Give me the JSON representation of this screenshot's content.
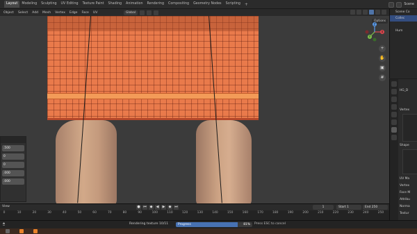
{
  "app": {
    "workspaces": [
      "Layout",
      "Modeling",
      "Sculpting",
      "UV Editing",
      "Texture Paint",
      "Shading",
      "Animation",
      "Rendering",
      "Compositing",
      "Geometry Nodes",
      "Scripting"
    ],
    "active_workspace": "Layout",
    "add_workspace": "+",
    "scene_label": "Scene"
  },
  "header": {
    "menus": [
      "Object",
      "Select",
      "Add",
      "Mesh",
      "Vertex",
      "Edge",
      "Face",
      "UV"
    ],
    "transform": "Global",
    "options": "Options"
  },
  "viewport": {
    "gizmo_axes": [
      "X",
      "Y",
      "Z"
    ]
  },
  "operator_panel": {
    "values": [
      ".500",
      "0",
      "0",
      ".000",
      ".000"
    ]
  },
  "timeline": {
    "menu": "View",
    "current_frame": "1",
    "start_label": "Start",
    "start": "1",
    "end_label": "End",
    "end": "250",
    "ruler": [
      "0",
      "10",
      "20",
      "30",
      "40",
      "50",
      "60",
      "70",
      "80",
      "90",
      "100",
      "110",
      "120",
      "130",
      "140",
      "150",
      "160",
      "170",
      "180",
      "190",
      "200",
      "210",
      "220",
      "230",
      "240",
      "250"
    ]
  },
  "status": {
    "rendering": "Rendering texture 10/11",
    "progress_label": "Progress",
    "progress_fraction": 0.81,
    "progress_percent": "81%",
    "cancel_hint": "Press ESC to cancel"
  },
  "outliner": {
    "rows": [
      "Scene Co",
      "Collec",
      "",
      "Hum",
      "",
      "",
      "",
      "",
      ""
    ]
  },
  "properties": {
    "object_name": "HG_D",
    "sections": [
      "Vertex",
      "Shape",
      "UV Ma",
      "Vertex",
      "Face M",
      "Attribu",
      "Norma",
      "Textur"
    ],
    "colors": {
      "accent": "#4772b3",
      "skirt": "#e97a4b"
    }
  }
}
